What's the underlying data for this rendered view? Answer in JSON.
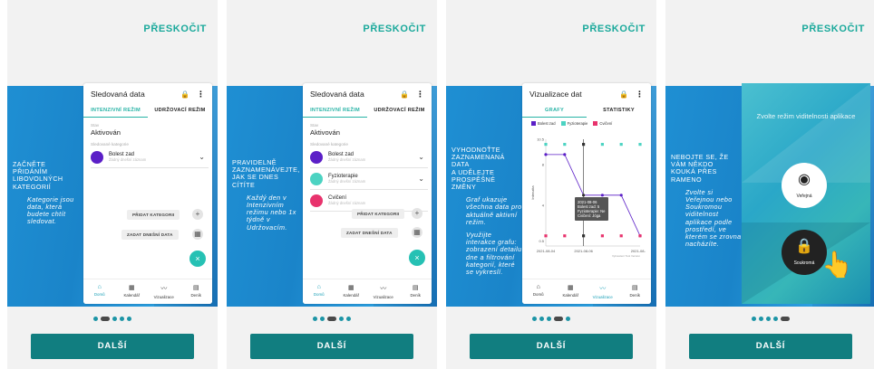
{
  "common": {
    "skip_label": "PŘESKOČIT",
    "next_label": "DALŠÍ",
    "pager_count": 5
  },
  "screens": [
    {
      "current_page": 2,
      "headline": [
        "ZAČNĚTE",
        "PŘIDÁNÍM",
        "LIBOVOLNÝCH",
        "KATEGORIÍ"
      ],
      "body": "Kategorie jsou data, která budete chtít sledovat."
    },
    {
      "current_page": 3,
      "headline": [
        "PRAVIDELNĚ",
        "ZAZNAMENÁVEJTE,",
        "JAK SE DNES",
        "CÍTÍTE"
      ],
      "body": "Každý den v Intenzivním režimu nebo 1x týdně v Udržovacím."
    },
    {
      "current_page": 4,
      "headline": [
        "VYHODNOŤTE",
        "ZAZNAMENANÁ",
        "DATA",
        "A UDĚLEJTE",
        "PROSPĚŠNÉ",
        "ZMĚNY"
      ],
      "body": "Graf ukazuje všechna data pro aktuálně aktivní režim.",
      "body2": "Využijte interakce grafu: zobrazení detailu dne a filtrování kategorií, které se vykreslí."
    },
    {
      "current_page": 5,
      "headline": [
        "NEBOJTE SE, ŽE",
        "VÁM NĚKDO",
        "KOUKÁ PŘES",
        "RAMENO"
      ],
      "body": "Zvolte si Veřejnou nebo Soukromou viditelnost aplikace podle prostředí, ve kterém se zrovna nacházíte."
    }
  ],
  "tracking_app": {
    "title": "Sledovaná data",
    "tab_intense": "INTENZIVNÍ REŽIM",
    "tab_maintain": "UDRŽOVACÍ REŽIM",
    "state_label": "Stav",
    "state_value": "Aktivován",
    "cats_label": "Sledované kategorie",
    "categories": [
      {
        "name": "Bolest zad",
        "sub": "Žádný dnešní záznam",
        "color": "#5b1fc7"
      },
      {
        "name": "Fyzioterapie",
        "sub": "Žádný dnešní záznam",
        "color": "#4cd3c2"
      },
      {
        "name": "Cvičení",
        "sub": "Žádný dnešní záznam",
        "color": "#e8336d"
      }
    ],
    "add_category": "PŘIDAT KATEGORII",
    "add_entry": "ZADAT DNEŠNÍ DATA",
    "nav": [
      "Domů",
      "Kalendář",
      "Vizualizace",
      "Deník"
    ]
  },
  "vis_app": {
    "title": "Vizualizace dat",
    "tab_graphs": "GRAFY",
    "tab_stats": "STATISTIKY",
    "legend": [
      {
        "name": "Bolest zad",
        "color": "#5b1fc7"
      },
      {
        "name": "Fyzioterapie",
        "color": "#4cd3c2"
      },
      {
        "name": "Cvičení",
        "color": "#e8336d"
      }
    ],
    "ylabel": "Intenzita",
    "x_ticks": [
      "2021-08-04",
      "2021-08-06",
      "2021-08-09"
    ],
    "y_ticks": [
      "10.5",
      "8",
      "4",
      "0.5"
    ],
    "tooltip_date": "2021-08-06",
    "tooltip_lines": [
      "Bolest zad: 5",
      "Fyzioterapie: Ne",
      "Cvičení: Jóga"
    ],
    "footer_note": "Vykreslení Tool Version"
  },
  "chart_data": {
    "type": "line",
    "x": [
      "2021-08-04",
      "2021-08-05",
      "2021-08-06",
      "2021-08-07",
      "2021-08-08",
      "2021-08-09"
    ],
    "ylim": [
      0,
      10.5
    ],
    "series": [
      {
        "name": "Bolest zad",
        "values": [
          9,
          9,
          5,
          5,
          5,
          1
        ]
      },
      {
        "name": "Fyzioterapie",
        "values": [
          10,
          10,
          10,
          10,
          10,
          10
        ]
      },
      {
        "name": "Cvičení",
        "values": [
          1,
          1,
          1,
          1,
          1,
          1
        ]
      }
    ]
  },
  "visibility": {
    "title": "Zvolte režim viditelnosti aplikace",
    "public_label": "Veřejná",
    "private_label": "Soukromá"
  }
}
